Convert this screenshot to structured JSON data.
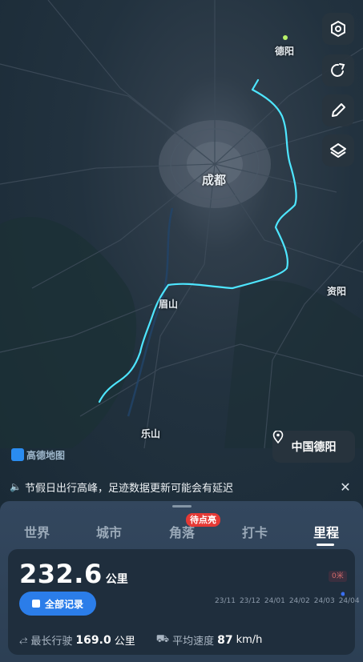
{
  "map": {
    "cities": [
      {
        "name": "德阳"
      },
      {
        "name": "成都"
      },
      {
        "name": "眉山"
      },
      {
        "name": "资阳"
      },
      {
        "name": "乐山"
      }
    ],
    "logo_text": "高德地图",
    "route_color": "#4ee6ff",
    "location_chip": "中国德阳"
  },
  "toolbar": {
    "icons": [
      "settings-hex-icon",
      "share-icon",
      "edit-pen-icon",
      "layers-icon"
    ]
  },
  "notice": {
    "text": "节假日出行高峰，足迹数据更新可能会有延迟",
    "close": "✕"
  },
  "tabs": [
    {
      "label": "世界"
    },
    {
      "label": "城市"
    },
    {
      "label": "角落"
    },
    {
      "label": "打卡"
    },
    {
      "label": "里程"
    }
  ],
  "active_tab": "里程",
  "badge": "待点亮",
  "summary": {
    "distance": "232.6",
    "unit": "公里",
    "all_records": "全部记录",
    "zero_label": "0米",
    "months": [
      "23/11",
      "23/12",
      "24/01",
      "24/02",
      "24/03",
      "24/04"
    ],
    "longest_label": "最长行驶",
    "longest_value": "169.0",
    "longest_unit": "公里",
    "speed_label": "平均速度",
    "speed_value": "87",
    "speed_unit": "km/h"
  },
  "colors": {
    "accent": "#2b7de9",
    "badge": "#e53935",
    "sheet": "#2f4257"
  }
}
